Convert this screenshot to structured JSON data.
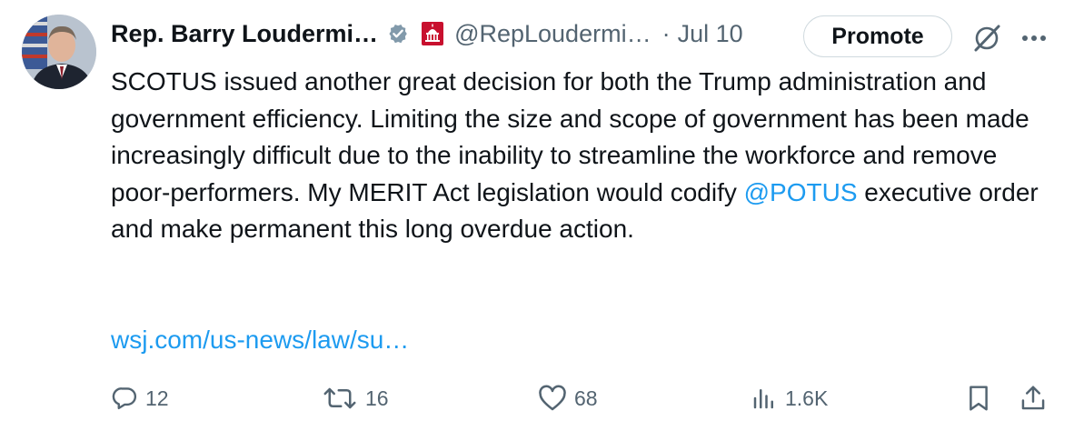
{
  "author": {
    "name": "Rep. Barry Loudermi…",
    "handle": "@RepLoudermi…",
    "separator": "·",
    "date": "Jul 10"
  },
  "promote_label": "Promote",
  "tweet": {
    "text_before_mention": "SCOTUS issued another great decision for both the Trump administration and government efficiency. Limiting the size and scope of government has been made increasingly difficult due to the inability to streamline the workforce and remove poor-performers. My MERIT Act legislation would codify ",
    "mention": "@POTUS",
    "text_after_mention": " executive order and make permanent this long overdue action.",
    "link": "wsj.com/us-news/law/su…"
  },
  "actions": {
    "replies": "12",
    "reposts": "16",
    "likes": "68",
    "views": "1.6K"
  },
  "colors": {
    "accent": "#1d9bf0",
    "muted": "#536471",
    "text": "#0f1419",
    "border": "#cfd9de"
  },
  "icons": [
    "verified-badge-icon",
    "government-badge-icon",
    "grok-icon",
    "more-icon",
    "reply-icon",
    "repost-icon",
    "like-icon",
    "views-icon",
    "bookmark-icon",
    "share-icon"
  ]
}
